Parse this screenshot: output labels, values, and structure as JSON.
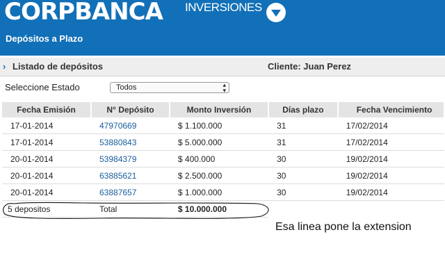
{
  "header": {
    "brand": "CORPBANCA",
    "brand_sub": "INVERSIONES",
    "page_title": "Depósitos a Plazo",
    "logo_icon": "circle-down-triangle-icon",
    "color": "#1170b8"
  },
  "subheader": {
    "breadcrumb": "Listado de depósitos",
    "client": "Cliente: Juan Perez"
  },
  "filter": {
    "label": "Seleccione Estado",
    "selected": "Todos"
  },
  "table": {
    "columns": [
      "Fecha Emisión",
      "N° Depósito",
      "Monto Inversión",
      "Días plazo",
      "Fecha Vencimiento"
    ],
    "rows": [
      [
        "17-01-2014",
        "47970669",
        "$ 1.100.000",
        "31",
        "17/02/2014"
      ],
      [
        "17-01-2014",
        "53880843",
        "$ 5.000.000",
        "31",
        "17/02/2014"
      ],
      [
        "20-01-2014",
        "53984379",
        "$ 400.000",
        "30",
        "19/02/2014"
      ],
      [
        "20-01-2014",
        "63885621",
        "$ 2.500.000",
        "30",
        "19/02/2014"
      ],
      [
        "20-01-2014",
        "63887657",
        "$ 1.000.000",
        "30",
        "19/02/2014"
      ]
    ],
    "total": {
      "count": "5 depositos",
      "label": "Total",
      "amount": "$ 10.000.000"
    }
  },
  "annotation": "Esa linea pone la extension"
}
